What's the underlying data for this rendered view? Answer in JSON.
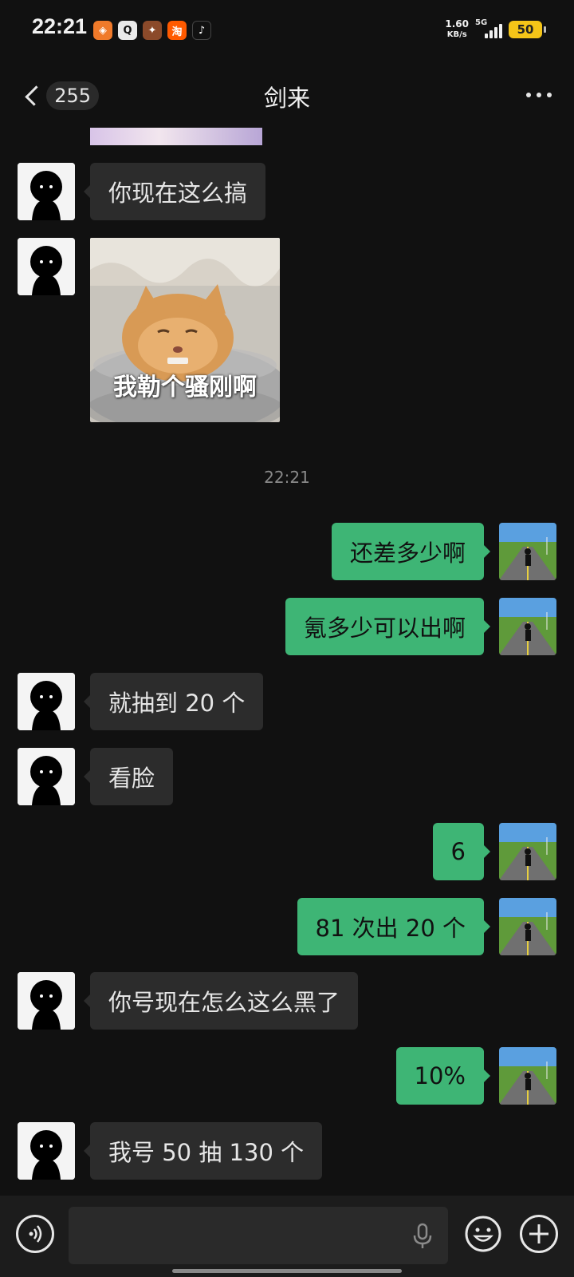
{
  "status_bar": {
    "time": "22:21",
    "net_speed_value": "1.60",
    "net_speed_unit": "KB/s",
    "network": "5G",
    "battery": "50",
    "app_icons": [
      {
        "name": "app-icon-orange",
        "glyph": "◈",
        "color": "#f07a2a"
      },
      {
        "name": "qq-icon",
        "glyph": "🐧",
        "color": "#222222"
      },
      {
        "name": "game-icon",
        "glyph": "✦",
        "color": "#8b4a2a"
      },
      {
        "name": "taobao-icon",
        "glyph": "淘",
        "color": "#ff5a00"
      },
      {
        "name": "tiktok-icon",
        "glyph": "♪",
        "color": "#111111"
      }
    ]
  },
  "header": {
    "unread_count": "255",
    "title": "剑来"
  },
  "messages": {
    "m1": "你现在这么搞",
    "sticker_caption": "我勒个骚刚啊",
    "timestamp": "22:21",
    "m2": "还差多少啊",
    "m3": "氪多少可以出啊",
    "m4": "就抽到 20 个",
    "m5": "看脸",
    "m6": "6",
    "m7": "81 次出 20 个",
    "m8": "你号现在怎么这么黑了",
    "m9": "10%",
    "m10": "我号 50 抽 130 个"
  },
  "colors": {
    "background": "#111111",
    "incoming_bubble": "#2c2c2c",
    "outgoing_bubble": "#3eb575"
  }
}
